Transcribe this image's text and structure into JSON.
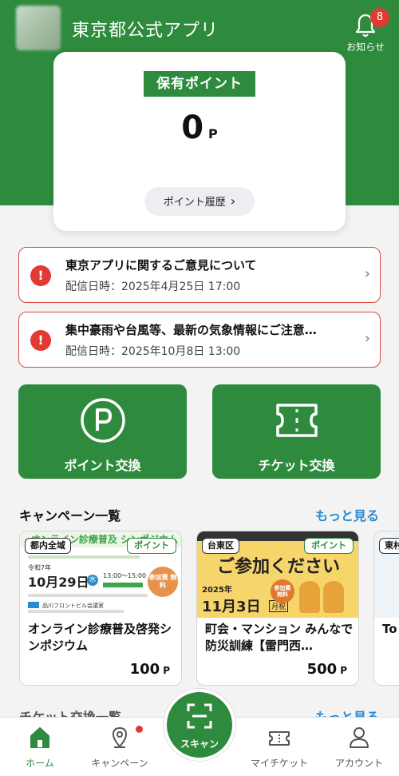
{
  "header": {
    "app_title": "東京都公式アプリ",
    "notification_count": "8",
    "notification_label": "お知らせ"
  },
  "points": {
    "label": "保有ポイント",
    "value": "0",
    "unit": "P",
    "history_label": "ポイント履歴"
  },
  "notices": [
    {
      "title": "東京アプリに関するご意見について",
      "date": "配信日時：2025年4月25日 17:00"
    },
    {
      "title": "集中豪雨や台風等、最新の気象情報にご注意…",
      "date": "配信日時：2025年10月8日 13:00"
    }
  ],
  "actions": {
    "point_exchange": "ポイント交換",
    "ticket_exchange": "チケット交換"
  },
  "campaigns": {
    "section_title": "キャンペーン一覧",
    "more_label": "もっと見る",
    "items": [
      {
        "area": "都内全域",
        "tag": "ポイント",
        "title": "オンライン診療普及啓発シンポジウム",
        "points": "100",
        "unit": "P",
        "image_text": {
          "banner": "オンライン診療普及 シンポジウム",
          "date": "10月29日",
          "weekday": "水",
          "year": "令和7年",
          "time": "13:00～15:00",
          "badge": "参加費 無料",
          "venue": "品川フロントビル会議室"
        }
      },
      {
        "area": "台東区",
        "tag": "ポイント",
        "title": "町会・マンション みんなで防災訓練【雷門西…",
        "points": "500",
        "unit": "P",
        "image_text": {
          "banner": "ご参加ください",
          "year": "2025年",
          "date": "11月3日",
          "weekday": "月祝",
          "badge": "参加費 無料"
        }
      },
      {
        "area": "東村",
        "title": "To タ…"
      }
    ]
  },
  "next_section_title": "チケット交換一覧",
  "next_section_more": "もっと見る",
  "bottom_nav": {
    "home": "ホーム",
    "campaign": "キャンペーン",
    "scan": "スキャン",
    "my_ticket": "マイチケット",
    "account": "アカウント"
  },
  "colors": {
    "brand_green": "#2e8b3d",
    "alert_red": "#e23a32",
    "link_blue": "#2a8bd0"
  }
}
